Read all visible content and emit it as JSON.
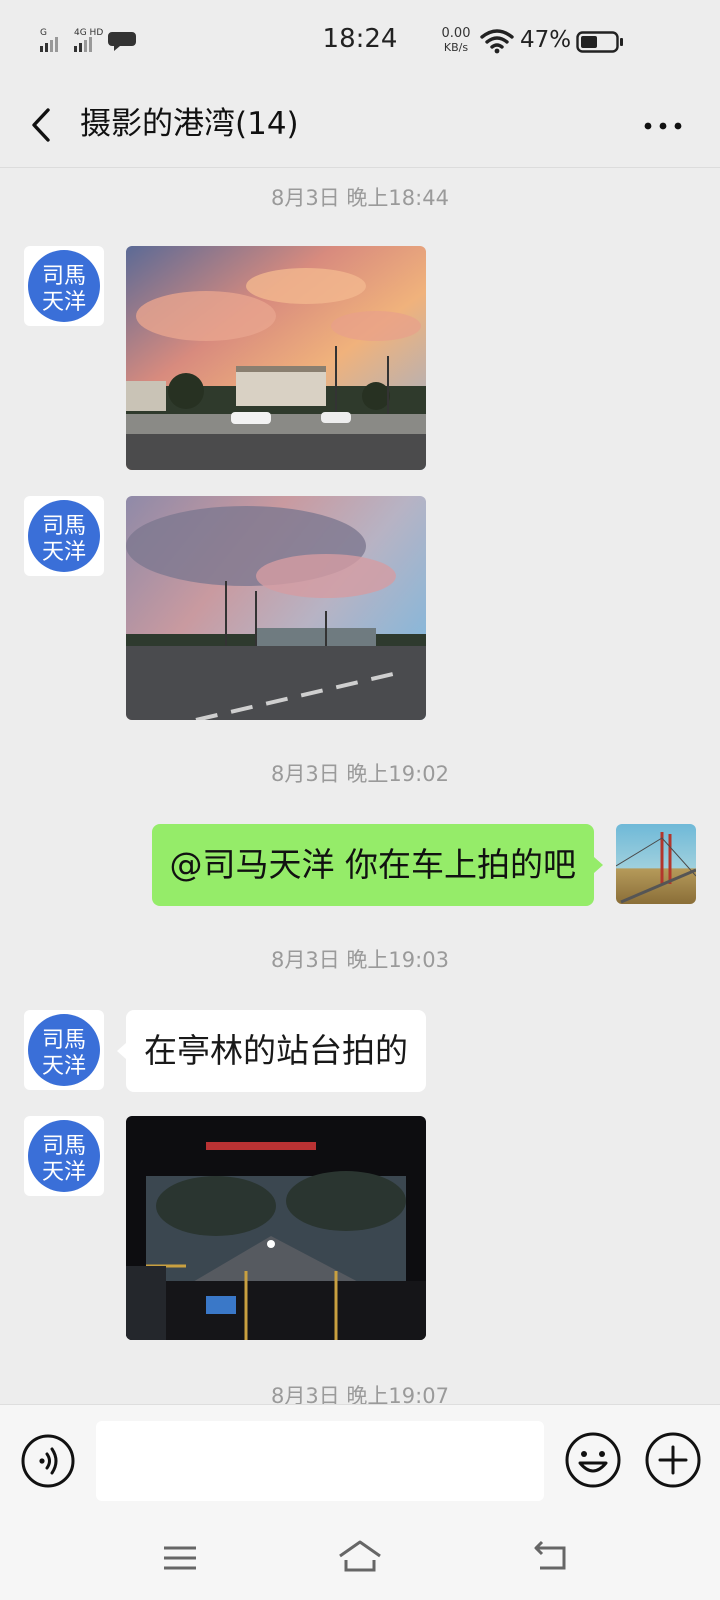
{
  "status_bar": {
    "network_1": "G",
    "network_2": "4G HD",
    "time": "18:24",
    "net_speed": "0.00",
    "net_speed_unit": "KB/s",
    "battery_percent": "47%",
    "battery_level": 0.47
  },
  "header": {
    "title": "摄影的港湾(14)"
  },
  "messages": [
    {
      "type": "timestamp",
      "text": "8月3日 晚上18:44"
    },
    {
      "type": "image",
      "sender": "司马天洋",
      "direction": "incoming",
      "content": "sunset-street-photo"
    },
    {
      "type": "image",
      "sender": "司马天洋",
      "direction": "incoming",
      "content": "sunset-road-photo"
    },
    {
      "type": "timestamp",
      "text": "8月3日 晚上19:02"
    },
    {
      "type": "text",
      "direction": "outgoing",
      "text": "@司马天洋  你在车上拍的吧"
    },
    {
      "type": "timestamp",
      "text": "8月3日 晚上19:03"
    },
    {
      "type": "text",
      "sender": "司马天洋",
      "direction": "incoming",
      "text": "在亭林的站台拍的"
    },
    {
      "type": "image",
      "sender": "司马天洋",
      "direction": "incoming",
      "content": "bus-windshield-photo"
    },
    {
      "type": "timestamp",
      "text": "8月3日 晚上19:07"
    }
  ],
  "avatar_incoming": {
    "line1": "司馬",
    "line2": "天洋",
    "color": "#3a6fd8"
  },
  "input_bar": {
    "placeholder": "",
    "value": ""
  },
  "colors": {
    "background": "#ededed",
    "outgoing_bubble": "#95ec69",
    "incoming_bubble": "#ffffff",
    "timestamp": "#9a9a9a"
  }
}
